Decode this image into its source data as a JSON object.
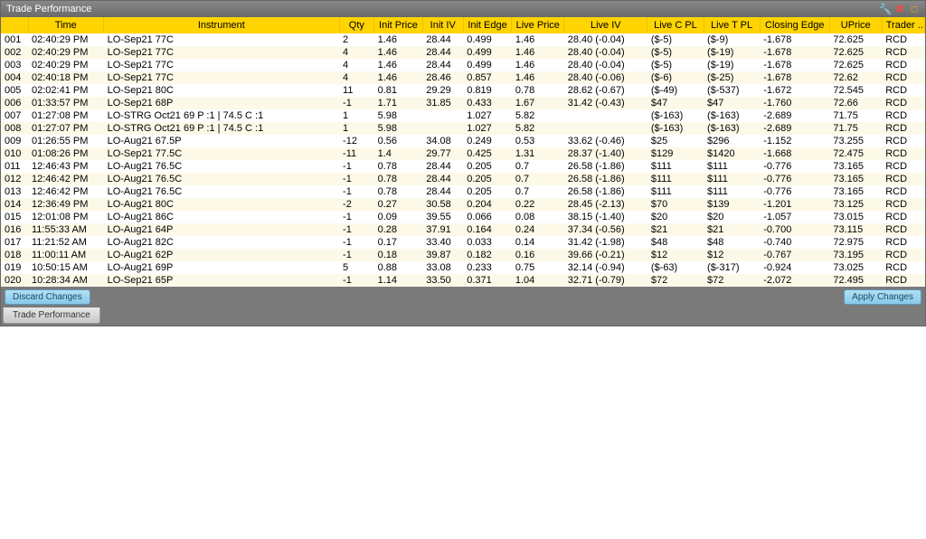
{
  "window": {
    "title": "Trade Performance"
  },
  "columns": {
    "idx": "",
    "time": "Time",
    "instrument": "Instrument",
    "qty": "Qty",
    "init_price": "Init Price",
    "init_iv": "Init IV",
    "init_edge": "Init Edge",
    "live_price": "Live Price",
    "live_iv": "Live IV",
    "live_c_pl": "Live C PL",
    "live_t_pl": "Live T PL",
    "closing_edge": "Closing Edge",
    "uprice": "UPrice",
    "trader": "Trader .."
  },
  "rows": [
    {
      "idx": "001",
      "time": "02:40:29 PM",
      "instr": "LO-Sep21 77C",
      "qty": "2",
      "ip": "1.46",
      "iv": "28.44",
      "ie": "0.499",
      "lp": "1.46",
      "liv": "28.40 (-0.04)",
      "lcp": "($-5)",
      "ltp": "($-9)",
      "ce": "-1.678",
      "up": "72.625",
      "tr": "RCD"
    },
    {
      "idx": "002",
      "time": "02:40:29 PM",
      "instr": "LO-Sep21 77C",
      "qty": "4",
      "ip": "1.46",
      "iv": "28.44",
      "ie": "0.499",
      "lp": "1.46",
      "liv": "28.40 (-0.04)",
      "lcp": "($-5)",
      "ltp": "($-19)",
      "ce": "-1.678",
      "up": "72.625",
      "tr": "RCD"
    },
    {
      "idx": "003",
      "time": "02:40:29 PM",
      "instr": "LO-Sep21 77C",
      "qty": "4",
      "ip": "1.46",
      "iv": "28.44",
      "ie": "0.499",
      "lp": "1.46",
      "liv": "28.40 (-0.04)",
      "lcp": "($-5)",
      "ltp": "($-19)",
      "ce": "-1.678",
      "up": "72.625",
      "tr": "RCD"
    },
    {
      "idx": "004",
      "time": "02:40:18 PM",
      "instr": "LO-Sep21 77C",
      "qty": "4",
      "ip": "1.46",
      "iv": "28.46",
      "ie": "0.857",
      "lp": "1.46",
      "liv": "28.40 (-0.06)",
      "lcp": "($-6)",
      "ltp": "($-25)",
      "ce": "-1.678",
      "up": "72.62",
      "tr": "RCD"
    },
    {
      "idx": "005",
      "time": "02:02:41 PM",
      "instr": "LO-Sep21 80C",
      "qty": "11",
      "ip": "0.81",
      "iv": "29.29",
      "ie": "0.819",
      "lp": "0.78",
      "liv": "28.62 (-0.67)",
      "lcp": "($-49)",
      "ltp": "($-537)",
      "ce": "-1.672",
      "up": "72.545",
      "tr": "RCD"
    },
    {
      "idx": "006",
      "time": "01:33:57 PM",
      "instr": "LO-Sep21 68P",
      "qty": "-1",
      "ip": "1.71",
      "iv": "31.85",
      "ie": "0.433",
      "lp": "1.67",
      "liv": "31.42 (-0.43)",
      "lcp": "$47",
      "ltp": "$47",
      "ce": "-1.760",
      "up": "72.66",
      "tr": "RCD"
    },
    {
      "idx": "007",
      "time": "01:27:08 PM",
      "instr": "LO-STRG Oct21 69 P :1 | 74.5 C :1",
      "qty": "1",
      "ip": "5.98",
      "iv": "",
      "ie": "1.027",
      "lp": "5.82",
      "liv": "",
      "lcp": "($-163)",
      "ltp": "($-163)",
      "ce": "-2.689",
      "up": "71.75",
      "tr": "RCD"
    },
    {
      "idx": "008",
      "time": "01:27:07 PM",
      "instr": "LO-STRG Oct21 69 P :1 | 74.5 C :1",
      "qty": "1",
      "ip": "5.98",
      "iv": "",
      "ie": "1.027",
      "lp": "5.82",
      "liv": "",
      "lcp": "($-163)",
      "ltp": "($-163)",
      "ce": "-2.689",
      "up": "71.75",
      "tr": "RCD"
    },
    {
      "idx": "009",
      "time": "01:26:55 PM",
      "instr": "LO-Aug21 67.5P",
      "qty": "-12",
      "ip": "0.56",
      "iv": "34.08",
      "ie": "0.249",
      "lp": "0.53",
      "liv": "33.62 (-0.46)",
      "lcp": "$25",
      "ltp": "$296",
      "ce": "-1.152",
      "up": "73.255",
      "tr": "RCD"
    },
    {
      "idx": "010",
      "time": "01:08:26 PM",
      "instr": "LO-Sep21 77.5C",
      "qty": "-11",
      "ip": "1.4",
      "iv": "29.77",
      "ie": "0.425",
      "lp": "1.31",
      "liv": "28.37 (-1.40)",
      "lcp": "$129",
      "ltp": "$1420",
      "ce": "-1.668",
      "up": "72.475",
      "tr": "RCD"
    },
    {
      "idx": "011",
      "time": "12:46:43 PM",
      "instr": "LO-Aug21 76.5C",
      "qty": "-1",
      "ip": "0.78",
      "iv": "28.44",
      "ie": "0.205",
      "lp": "0.7",
      "liv": "26.58 (-1.86)",
      "lcp": "$111",
      "ltp": "$111",
      "ce": "-0.776",
      "up": "73.165",
      "tr": "RCD"
    },
    {
      "idx": "012",
      "time": "12:46:42 PM",
      "instr": "LO-Aug21 76.5C",
      "qty": "-1",
      "ip": "0.78",
      "iv": "28.44",
      "ie": "0.205",
      "lp": "0.7",
      "liv": "26.58 (-1.86)",
      "lcp": "$111",
      "ltp": "$111",
      "ce": "-0.776",
      "up": "73.165",
      "tr": "RCD"
    },
    {
      "idx": "013",
      "time": "12:46:42 PM",
      "instr": "LO-Aug21 76.5C",
      "qty": "-1",
      "ip": "0.78",
      "iv": "28.44",
      "ie": "0.205",
      "lp": "0.7",
      "liv": "26.58 (-1.86)",
      "lcp": "$111",
      "ltp": "$111",
      "ce": "-0.776",
      "up": "73.165",
      "tr": "RCD"
    },
    {
      "idx": "014",
      "time": "12:36:49 PM",
      "instr": "LO-Aug21 80C",
      "qty": "-2",
      "ip": "0.27",
      "iv": "30.58",
      "ie": "0.204",
      "lp": "0.22",
      "liv": "28.45 (-2.13)",
      "lcp": "$70",
      "ltp": "$139",
      "ce": "-1.201",
      "up": "73.125",
      "tr": "RCD"
    },
    {
      "idx": "015",
      "time": "12:01:08 PM",
      "instr": "LO-Aug21 86C",
      "qty": "-1",
      "ip": "0.09",
      "iv": "39.55",
      "ie": "0.066",
      "lp": "0.08",
      "liv": "38.15 (-1.40)",
      "lcp": "$20",
      "ltp": "$20",
      "ce": "-1.057",
      "up": "73.015",
      "tr": "RCD"
    },
    {
      "idx": "016",
      "time": "11:55:33 AM",
      "instr": "LO-Aug21 64P",
      "qty": "-1",
      "ip": "0.28",
      "iv": "37.91",
      "ie": "0.164",
      "lp": "0.24",
      "liv": "37.34 (-0.56)",
      "lcp": "$21",
      "ltp": "$21",
      "ce": "-0.700",
      "up": "73.115",
      "tr": "RCD"
    },
    {
      "idx": "017",
      "time": "11:21:52 AM",
      "instr": "LO-Aug21 82C",
      "qty": "-1",
      "ip": "0.17",
      "iv": "33.40",
      "ie": "0.033",
      "lp": "0.14",
      "liv": "31.42 (-1.98)",
      "lcp": "$48",
      "ltp": "$48",
      "ce": "-0.740",
      "up": "72.975",
      "tr": "RCD"
    },
    {
      "idx": "018",
      "time": "11:00:11 AM",
      "instr": "LO-Aug21 62P",
      "qty": "-1",
      "ip": "0.18",
      "iv": "39.87",
      "ie": "0.182",
      "lp": "0.16",
      "liv": "39.66 (-0.21)",
      "lcp": "$12",
      "ltp": "$12",
      "ce": "-0.767",
      "up": "73.195",
      "tr": "RCD"
    },
    {
      "idx": "019",
      "time": "10:50:15 AM",
      "instr": "LO-Aug21 69P",
      "qty": "5",
      "ip": "0.88",
      "iv": "33.08",
      "ie": "0.233",
      "lp": "0.75",
      "liv": "32.14 (-0.94)",
      "lcp": "($-63)",
      "ltp": "($-317)",
      "ce": "-0.924",
      "up": "73.025",
      "tr": "RCD"
    },
    {
      "idx": "020",
      "time": "10:28:34 AM",
      "instr": "LO-Sep21 65P",
      "qty": "-1",
      "ip": "1.14",
      "iv": "33.50",
      "ie": "0.371",
      "lp": "1.04",
      "liv": "32.71 (-0.79)",
      "lcp": "$72",
      "ltp": "$72",
      "ce": "-2.072",
      "up": "72.495",
      "tr": "RCD"
    }
  ],
  "buttons": {
    "discard": "Discard Changes",
    "apply": "Apply Changes"
  },
  "tabs": {
    "trade_perf": "Trade Performance"
  }
}
